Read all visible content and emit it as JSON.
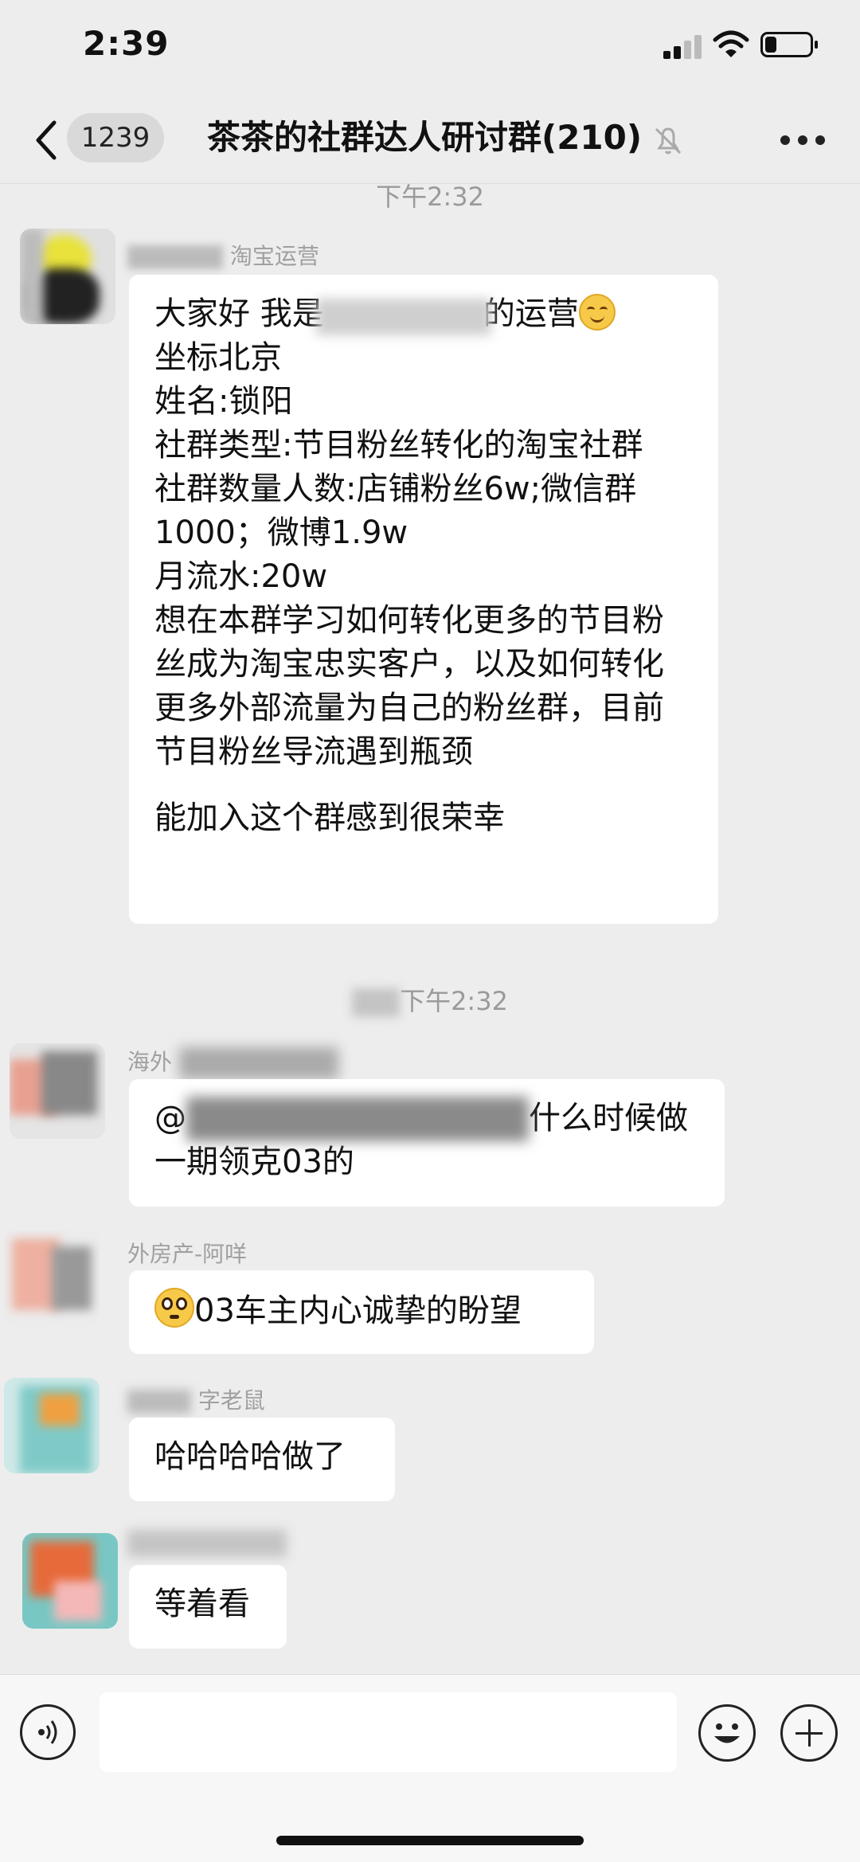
{
  "status_bar": {
    "time": "2:39"
  },
  "nav": {
    "unread_count": "1239",
    "title": "茶茶的社群达人研讨群(210)",
    "icons": {
      "back": "chevron-left-icon",
      "mute": "bell-off-icon",
      "more": "more-dots-icon"
    }
  },
  "timestamps": [
    "下午2:32",
    "下午2:32"
  ],
  "messages": [
    {
      "sender": "淘宝运营",
      "lines": [
        "大家好 我是",
        "的运营",
        "坐标北京",
        "姓名:锁阳",
        "社群类型:节目粉丝转化的淘宝社群",
        "社群数量人数:店铺粉丝6w;微信群1000；微博1.9w",
        "月流水:20w",
        "想在本群学习如何转化更多的节目粉丝成为淘宝忠实客户，以及如何转化更多外部流量为自己的粉丝群，目前节目粉丝导流遇到瓶颈",
        "能加入这个群感到很荣幸"
      ],
      "emoji": "smiling-face-icon"
    },
    {
      "sender": "海外",
      "text_prefix": "@",
      "text": "什么时候做一期领克03的"
    },
    {
      "sender": "外房产-阿咩",
      "text": "03车主内心诚挚的盼望",
      "emoji": "flushed-face-icon"
    },
    {
      "sender": "字老鼠",
      "text": "哈哈哈哈做了"
    },
    {
      "sender": "",
      "text": "等着看"
    }
  ],
  "input_bar": {
    "placeholder": "",
    "icons": {
      "voice": "voice-icon",
      "emoji": "emoji-icon",
      "plus": "plus-icon"
    }
  },
  "colors": {
    "background": "#ededed",
    "bubble": "#ffffff",
    "timestamp": "#9a9a9a"
  }
}
